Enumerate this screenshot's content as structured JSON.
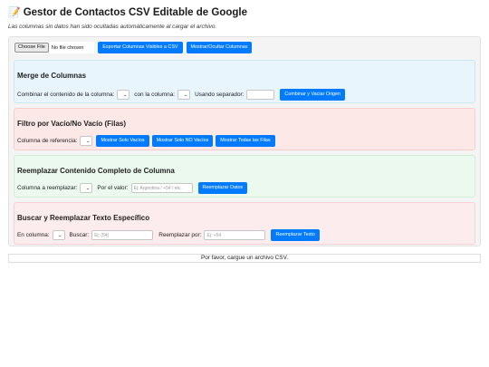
{
  "header": {
    "emoji": "📝",
    "title": "Gestor de Contactos CSV Editable de Google",
    "subtitle": "Las columnas sin datos han sido ocultadas automáticamente al cargar el archivo."
  },
  "toolbar": {
    "file_button": "Choose File",
    "file_status": "No file chosen",
    "export_label": "Exportar Columnas Visibles a CSV",
    "toggle_label": "Mostrar/Ocultar Columnas"
  },
  "merge": {
    "title": "Merge de Columnas",
    "combine_label": "Combinar el contenido de la columna:",
    "with_label": "con la columna:",
    "separator_label": "Usando separador:",
    "separator_value": "",
    "button_label": "Combinar y Vaciar Origen"
  },
  "filter": {
    "title": "Filtro por Vacío/No Vacío (Filas)",
    "ref_label": "Columna de referencia:",
    "show_empty": "Mostrar Solo Vacíos",
    "show_not_empty": "Mostrar Solo NO Vacíos",
    "show_all": "Mostrar Todas las Filas"
  },
  "replace_column": {
    "title": "Reemplazar Contenido Completo de Columna",
    "column_label": "Columna a reemplazar:",
    "value_label": "Por el valor:",
    "value_placeholder": "Ej: Argentina / +54 / etc.",
    "button_label": "Reemplazar Datos"
  },
  "find_replace": {
    "title": "Buscar y Reemplazar Texto Específico",
    "column_label": "En columna:",
    "search_label": "Buscar:",
    "search_placeholder": "Ej: (54)",
    "replace_label": "Reemplazar por:",
    "replace_placeholder": "Ej: +54",
    "button_label": "Reemplazar Texto"
  },
  "status": {
    "message": "Por favor, cargue un archivo CSV."
  },
  "colors": {
    "primary_button": "#007bff",
    "merge_bg": "#e9f5fd",
    "filter_bg": "#fde8e8",
    "replace_bg": "#ebf9ee",
    "find_bg": "#fdeced"
  }
}
